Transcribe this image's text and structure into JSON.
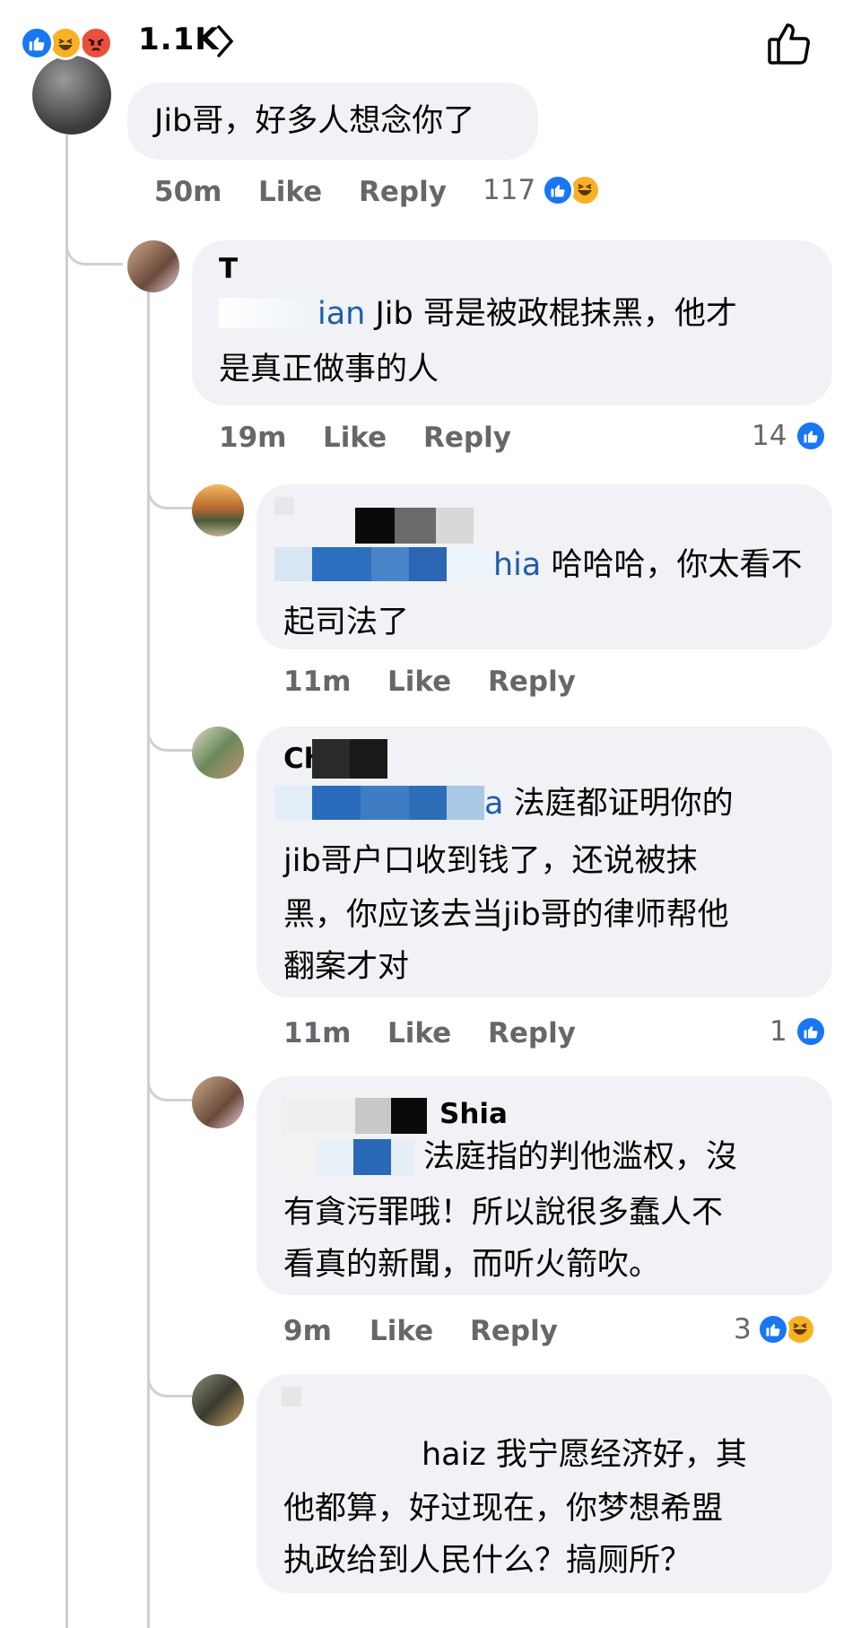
{
  "header": {
    "reaction_count": "1.1K",
    "reactions": [
      "like-icon",
      "haha-icon",
      "angry-icon"
    ]
  },
  "comments": [
    {
      "name": "",
      "mention": "",
      "text_lines": [
        "Jib哥，好多人想念你了"
      ],
      "time": "50m",
      "like_label": "Like",
      "reply_label": "Reply",
      "reaction_count": "117",
      "reactions": [
        "like-icon",
        "haha-icon"
      ]
    },
    {
      "name": "T",
      "mention": "ian",
      "text_lines": [
        " Jib 哥是被政棍抹黑，他才",
        "是真正做事的人"
      ],
      "time": "19m",
      "like_label": "Like",
      "reply_label": "Reply",
      "reaction_count": "14",
      "reactions": [
        "like-icon"
      ]
    },
    {
      "name": "",
      "mention": "hia",
      "text_lines": [
        " 哈哈哈，你太看不",
        "起司法了"
      ],
      "time": "11m",
      "like_label": "Like",
      "reply_label": "Reply",
      "reaction_count": "",
      "reactions": []
    },
    {
      "name": "Ch",
      "mention": "a",
      "text_lines": [
        " 法庭都证明你的",
        "jib哥户口收到钱了，还说被抹",
        "黑，你应该去当jib哥的律师帮他",
        "翻案才对"
      ],
      "time": "11m",
      "like_label": "Like",
      "reply_label": "Reply",
      "reaction_count": "1",
      "reactions": [
        "like-icon"
      ]
    },
    {
      "name": "Shia",
      "mention": "",
      "text_lines": [
        "法庭指的判他滥权，沒",
        "有貪污罪哦！所以說很多蠢人不",
        "看真的新聞，而听火箭吹。"
      ],
      "time": "9m",
      "like_label": "Like",
      "reply_label": "Reply",
      "reaction_count": "3",
      "reactions": [
        "like-icon",
        "haha-icon"
      ]
    },
    {
      "name": "",
      "mention": "",
      "text_lines": [
        "haiz 我宁愿经济好，其",
        "他都算，好过现在，你梦想希盟",
        "执政给到人民什么？搞厕所？"
      ],
      "time": "",
      "like_label": "",
      "reply_label": "",
      "reaction_count": "",
      "reactions": []
    }
  ],
  "colors": {
    "like_blue": "#1877f2",
    "haha_yellow": "#f7b125",
    "angry_red": "#e9503c",
    "bubble": "#f0f2f5",
    "meta_gray": "#65676b",
    "mention": "#1f5ea8"
  }
}
